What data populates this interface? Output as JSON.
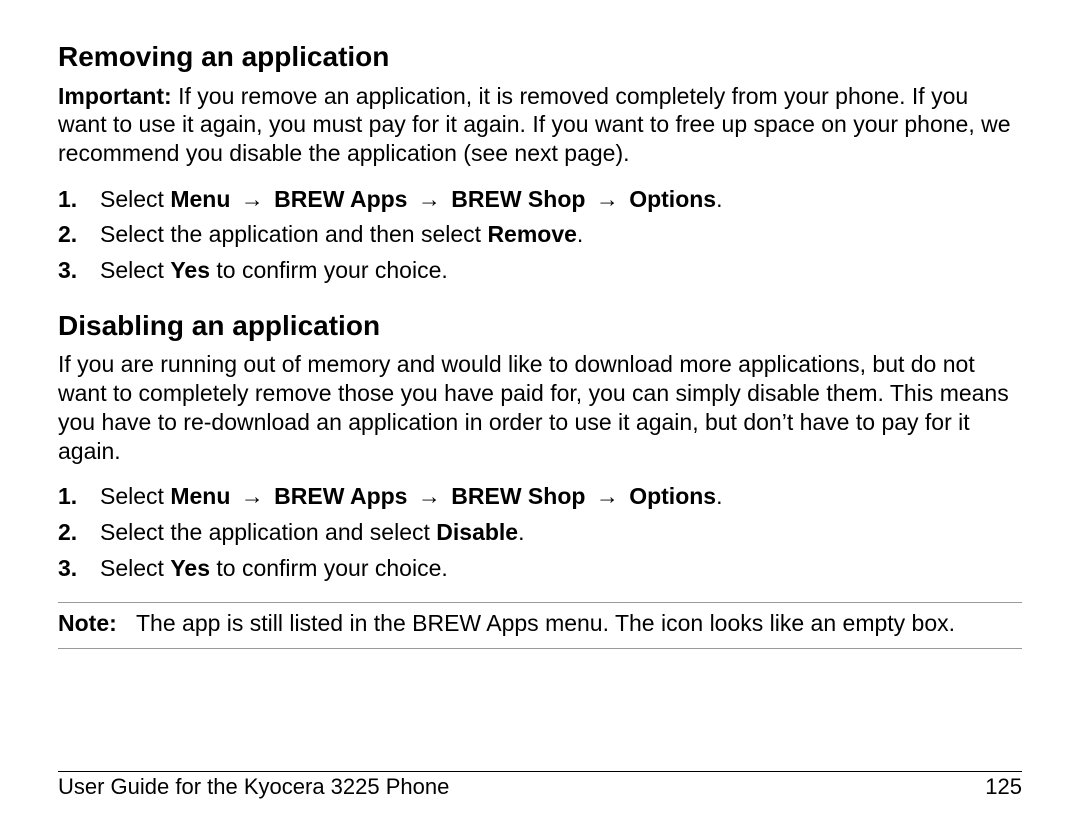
{
  "section1": {
    "heading": "Removing an application",
    "important_label": "Important:",
    "important_text": " If you remove an application, it is removed completely from your phone. If you want to use it again, you must pay for it again. If you want to free up space on your phone, we recommend you disable the application (see next page).",
    "steps": {
      "s1_pre": "Select ",
      "menu": "Menu",
      "brew_apps": "BREW Apps",
      "brew_shop": "BREW Shop",
      "options": "Options",
      "arrow": "→",
      "s2_pre": "Select the application and then select ",
      "remove": "Remove",
      "s3_pre": "Select ",
      "yes": "Yes",
      "s3_post": " to confirm your choice."
    }
  },
  "section2": {
    "heading": "Disabling an application",
    "intro": "If you are running out of memory and would like to download more applications, but do not want to completely remove those you have paid for, you can simply disable them. This means you have to re-download an application in order to use it again, but don’t have to pay for it again.",
    "steps": {
      "s1_pre": "Select ",
      "menu": "Menu",
      "brew_apps": "BREW Apps",
      "brew_shop": "BREW Shop",
      "options": "Options",
      "arrow": "→",
      "s2_pre": "Select the application and select ",
      "disable": "Disable",
      "s3_pre": "Select ",
      "yes": "Yes",
      "s3_post": " to confirm your choice."
    },
    "note_label": "Note:",
    "note_text": "The app is still listed in the BREW Apps menu. The icon looks like an empty box."
  },
  "markers": {
    "one": "1.",
    "two": "2.",
    "three": "3."
  },
  "punct": {
    "period": "."
  },
  "footer": {
    "title": "User Guide for the Kyocera 3225 Phone",
    "page": "125"
  }
}
